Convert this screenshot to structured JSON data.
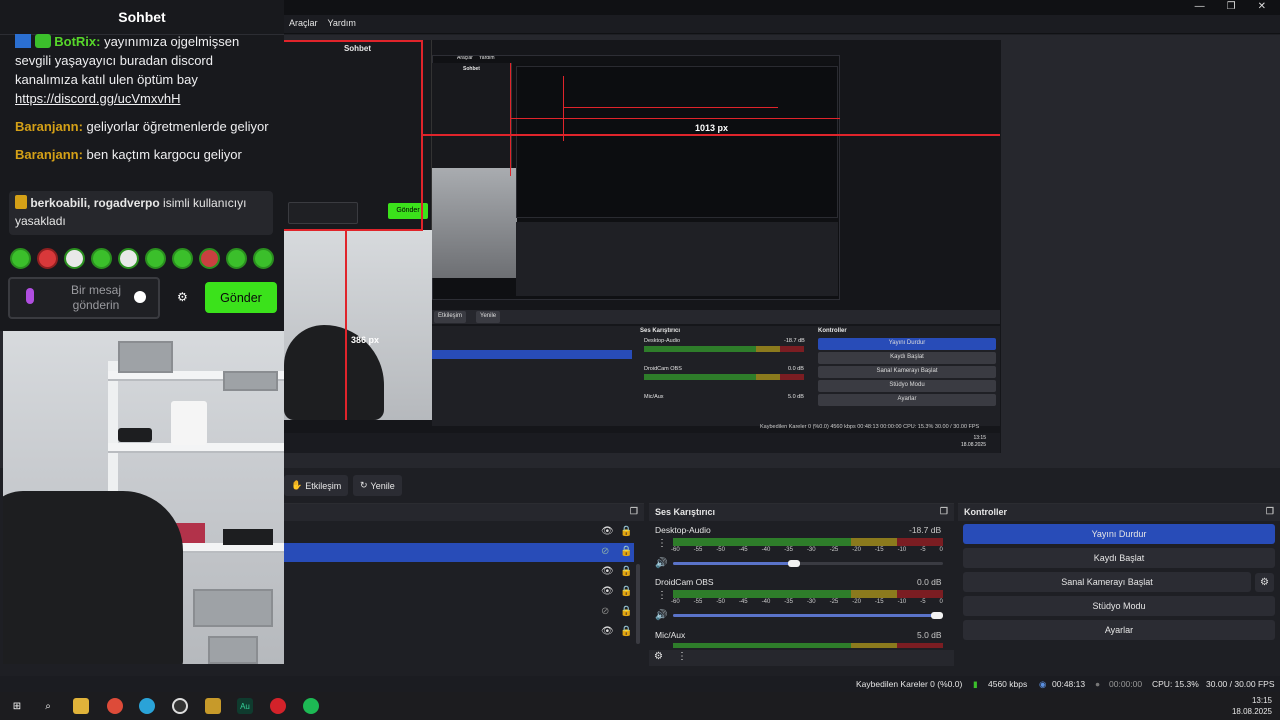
{
  "window": {
    "menu": [
      "Araçlar",
      "Yardım"
    ],
    "controls": [
      "—",
      "❐",
      "✕"
    ]
  },
  "preview": {
    "measure_horizontal": "1013 px",
    "measure_vertical": "386 px",
    "inner_chat_title": "Sohbet",
    "inner_menu": [
      "Araçlar",
      "Yardım"
    ],
    "inner_buttons": [
      "Etkileşim",
      "Yenile"
    ],
    "inner_mixer_title": "Ses Karıştırıcı",
    "inner_controls_title": "Kontroller",
    "inner_controls": [
      "Yayını Durdur",
      "Kaydı Başlat",
      "Sanal Kamerayı Başlat",
      "Stüdyo Modu",
      "Ayarlar"
    ],
    "inner_tracks": [
      {
        "name": "Desktop-Audio",
        "db": "-18.7 dB"
      },
      {
        "name": "DroidCam OBS",
        "db": "0.0 dB"
      },
      {
        "name": "Mic/Aux",
        "db": "5.0 dB"
      }
    ],
    "inner_status": "Kaybedilen Kareler 0 (%0.0)   4560 kbps   00:48:13   00:00:00   CPU: 15.3%   30.00 / 30.00 FPS",
    "inner_clock": [
      "13:15",
      "18.08.2025"
    ]
  },
  "toolbar": {
    "interact_label": "Etkileşim",
    "refresh_label": "Yenile"
  },
  "sources": {
    "rows": [
      {
        "selected": false
      },
      {
        "selected": true
      },
      {
        "selected": false
      },
      {
        "selected": false
      },
      {
        "selected": false
      },
      {
        "selected": false
      }
    ]
  },
  "mixer": {
    "title": "Ses Karıştırıcı",
    "ticks": [
      "-60",
      "-55",
      "-50",
      "-45",
      "-40",
      "-35",
      "-30",
      "-25",
      "-20",
      "-15",
      "-10",
      "-5",
      "0"
    ],
    "tracks": [
      {
        "name": "Desktop-Audio",
        "db": "-18.7 dB",
        "volume_fraction": 0.47
      },
      {
        "name": "DroidCam OBS",
        "db": "0.0 dB",
        "volume_fraction": 1.0
      },
      {
        "name": "Mic/Aux",
        "db": "5.0 dB",
        "volume_fraction": 1.0
      }
    ]
  },
  "controls": {
    "title": "Kontroller",
    "stop_stream": "Yayını Durdur",
    "start_record": "Kaydı Başlat",
    "start_virtualcam": "Sanal Kamerayı Başlat",
    "studio_mode": "Stüdyo Modu",
    "settings": "Ayarlar"
  },
  "status": {
    "dropped": "Kaybedilen Kareler 0 (%0.0)",
    "bitrate": "4560 kbps",
    "stream_time": "00:48:13",
    "record_time": "00:00:00",
    "cpu": "CPU: 15.3%",
    "fps": "30.00 / 30.00 FPS"
  },
  "taskbar": {
    "time": "13:15",
    "date": "18.08.2025",
    "apps": [
      "windows-start-icon",
      "search-icon",
      "file-explorer-icon",
      "chrome-icon",
      "telegram-icon",
      "obs-icon",
      "app-icon",
      "audition-icon",
      "opera-icon",
      "spotify-icon"
    ]
  },
  "chat": {
    "title": "Sohbet",
    "messages": [
      {
        "nick": "BotRix:",
        "nick_color": "#57d62a",
        "text": " yayınımıza ojgelmişsen sevgili yaşayayıcı buradan discord kanalımıza katıl ulen öptüm bay ",
        "link": "https://discord.gg/ucVmxvhH"
      },
      {
        "nick": "Baranjann:",
        "nick_color": "#d4a017",
        "text": " geliyorlar öğretmenlerde geliyor"
      },
      {
        "nick": "Baranjann:",
        "nick_color": "#d4a017",
        "text": " ben kaçtım kargocu geliyor"
      }
    ],
    "mod_nicks": "berkoabili, rogadverpo",
    "mod_text": " isimli kullanıcıyı yasakladı",
    "input_placeholder": "Bir mesaj gönderin",
    "send_label": "Gönder"
  },
  "colors": {
    "accent_blue": "#284cb8",
    "send_green": "#3be21b",
    "measure_red": "#e0242b"
  }
}
